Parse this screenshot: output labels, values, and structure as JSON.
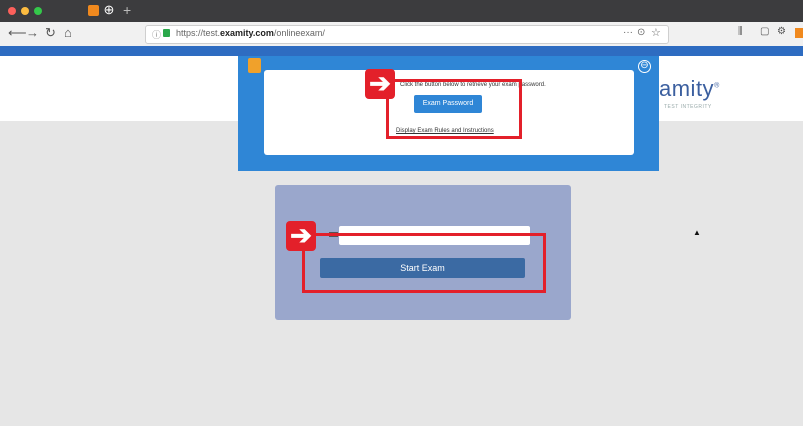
{
  "browser": {
    "url_prefix": "https://test.",
    "url_domain": "examity.com",
    "url_path": "/onlineexam/",
    "url_info_icon": "info-icon",
    "url_lock_icon": "lock-icon",
    "nav_icons": [
      "back-icon",
      "forward-icon",
      "reload-icon",
      "home-icon"
    ]
  },
  "brand": {
    "name": "amity",
    "registered": "®",
    "tagline": "TEST INTEGRITY"
  },
  "modal": {
    "instructions": "Click the button below to retrieve your exam password.",
    "exam_password_button": "Exam Password",
    "rules_link": "Display Exam Rules and Instructions",
    "close_icon_glyph": "⊖"
  },
  "login": {
    "input_value": "",
    "start_button": "Start Exam"
  },
  "annotations": {
    "arrow_glyph": "➔",
    "accent": "#e3202a"
  },
  "colors": {
    "brand_blue": "#2e6cc1",
    "panel": "#9aa7cc",
    "start_button": "#3b6aa3"
  }
}
